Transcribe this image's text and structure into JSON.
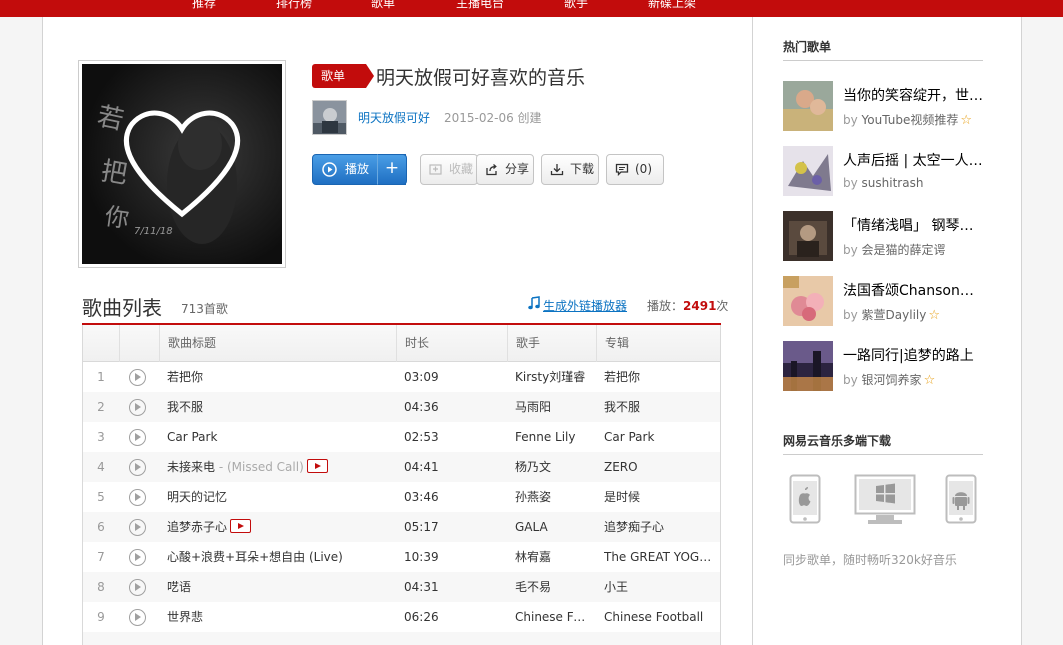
{
  "topnav": {
    "items": [
      "推荐",
      "排行榜",
      "歌单",
      "主播电台",
      "歌手",
      "新碟上架"
    ]
  },
  "playlist": {
    "badge": "歌单",
    "title": "明天放假可好喜欢的音乐",
    "creator": "明天放假可好",
    "created": "2015-02-06 创建",
    "cover_text": "若把你"
  },
  "actions": {
    "play": "播放",
    "add": "+",
    "collect": "收藏",
    "share": "分享",
    "download": "下载",
    "comment": "(0)"
  },
  "songlist": {
    "title": "歌曲列表",
    "count": "713首歌",
    "outchain": "生成外链播放器",
    "plays_label": "播放：",
    "plays_count": "2491",
    "plays_unit": "次",
    "headers": [
      "歌曲标题",
      "时长",
      "歌手",
      "专辑"
    ],
    "rows": [
      {
        "idx": "1",
        "title": "若把你",
        "alias": "",
        "mv": false,
        "duration": "03:09",
        "singer": "Kirsty刘瑾睿",
        "album": "若把你"
      },
      {
        "idx": "2",
        "title": "我不服",
        "alias": "",
        "mv": false,
        "duration": "04:36",
        "singer": "马雨阳",
        "album": "我不服"
      },
      {
        "idx": "3",
        "title": "Car Park",
        "alias": "",
        "mv": false,
        "duration": "02:53",
        "singer": "Fenne Lily",
        "album": "Car Park"
      },
      {
        "idx": "4",
        "title": "未接来电",
        "alias": " - (Missed Call)",
        "mv": true,
        "duration": "04:41",
        "singer": "杨乃文",
        "album": "ZERO"
      },
      {
        "idx": "5",
        "title": "明天的记忆",
        "alias": "",
        "mv": false,
        "duration": "03:46",
        "singer": "孙燕姿",
        "album": "是时候"
      },
      {
        "idx": "6",
        "title": "追梦赤子心",
        "alias": "",
        "mv": true,
        "duration": "05:17",
        "singer": "GALA",
        "album": "追梦痴子心"
      },
      {
        "idx": "7",
        "title": "心酸+浪费+耳朵+想自由 (Live)",
        "alias": "",
        "mv": false,
        "duration": "10:39",
        "singer": "林宥嘉",
        "album": "The GREAT YOGA 演唱会"
      },
      {
        "idx": "8",
        "title": "呓语",
        "alias": "",
        "mv": false,
        "duration": "04:31",
        "singer": "毛不易",
        "album": "小王"
      },
      {
        "idx": "9",
        "title": "世界悲",
        "alias": "",
        "mv": false,
        "duration": "06:26",
        "singer": "Chinese Football",
        "album": "Chinese Football"
      }
    ]
  },
  "sidebar": {
    "hot_heading": "热门歌单",
    "hot_lists": [
      {
        "title": "当你的笑容绽开，世界都变得明亮",
        "by": "by",
        "name": "YouTube视频推荐",
        "star": true
      },
      {
        "title": "人声后摇 | 太空一人独行",
        "by": "by",
        "name": "sushitrash",
        "star": false
      },
      {
        "title": "「情绪浅唱」 钢琴与人声",
        "by": "by",
        "name": "会是猫的薛定谔",
        "star": false
      },
      {
        "title": "法国香颂Chanson—浪漫",
        "by": "by",
        "name": "紫萱Daylily",
        "star": true
      },
      {
        "title": "一路同行|追梦的路上",
        "by": "by",
        "name": "银河饲养家",
        "star": true
      }
    ],
    "download_heading": "网易云音乐多端下载",
    "sync_text": "同步歌单，随时畅听320k好音乐"
  },
  "colors": {
    "brand_red": "#c20c0c",
    "link_blue": "#0c73c2",
    "play_blue": "#2a7fd0",
    "star_orange": "#e8a016"
  }
}
